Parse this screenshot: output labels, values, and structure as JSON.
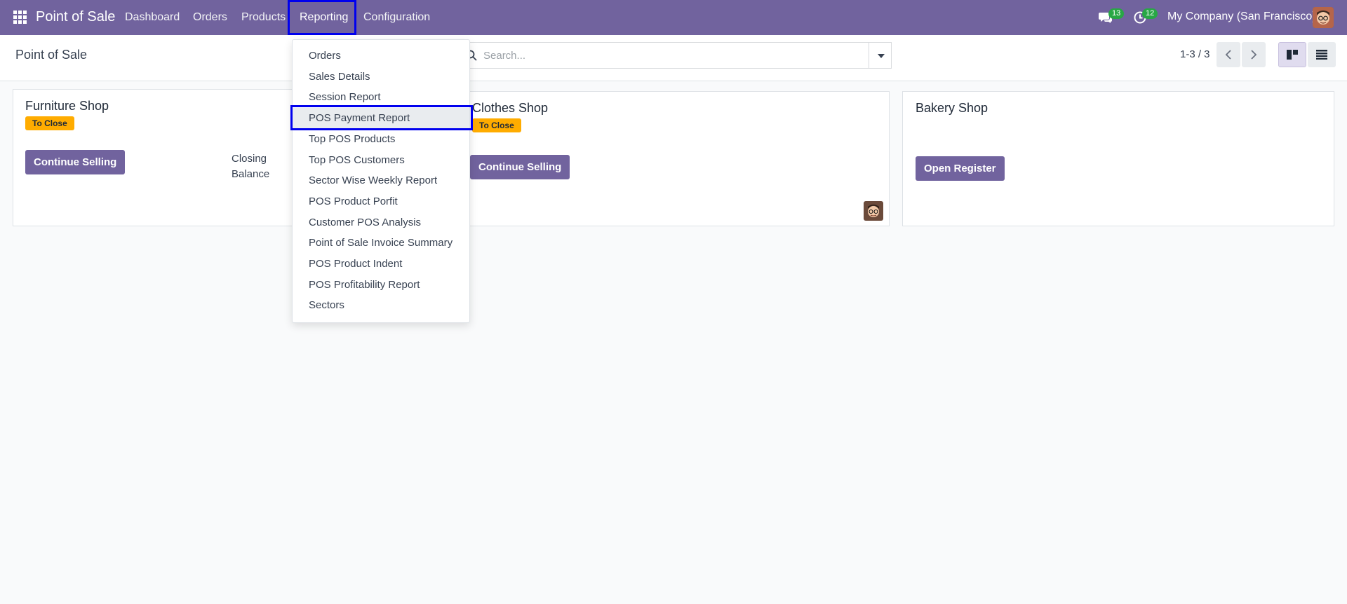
{
  "navbar": {
    "brand": "Point of Sale",
    "menu": [
      "Dashboard",
      "Orders",
      "Products",
      "Reporting",
      "Configuration"
    ],
    "messages_count": "13",
    "activities_count": "12",
    "company": "My Company (San Francisco)"
  },
  "control_panel": {
    "title": "Point of Sale",
    "search_placeholder": "Search...",
    "pager": "1-3 / 3"
  },
  "cards": [
    {
      "name": "Furniture Shop",
      "status": "To Close",
      "button": "Continue Selling",
      "closing_label": "Closing",
      "balance_label": "Balance"
    },
    {
      "name": "Clothes Shop",
      "status": "To Close",
      "button": "Continue Selling"
    },
    {
      "name": "Bakery Shop",
      "button": "Open Register"
    }
  ],
  "reporting_menu": {
    "items": [
      "Orders",
      "Sales Details",
      "Session Report",
      "POS Payment Report",
      "Top POS Products",
      "Top POS Customers",
      "Sector Wise Weekly Report",
      "POS Product Porfit",
      "Customer POS Analysis",
      "Point of Sale Invoice Summary",
      "POS Product Indent",
      "POS Profitability Report",
      "Sectors"
    ],
    "active_item": "POS Payment Report"
  },
  "colors": {
    "brand": "#71639e",
    "highlight": "#0000ee",
    "tag": "#ffac00",
    "badge": "#28a745"
  }
}
